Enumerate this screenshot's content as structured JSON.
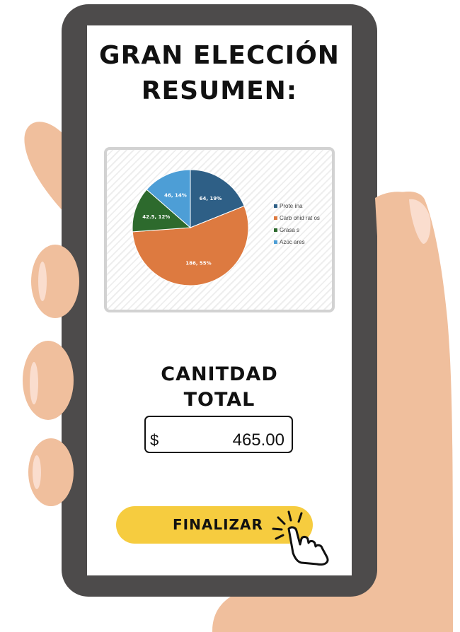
{
  "header": {
    "title_line1": "GRAN ELECCIÓN",
    "title_line2": "RESUMEN:"
  },
  "chart_data": {
    "type": "pie",
    "categories": [
      "Prote ína",
      "Carb ohid rat os",
      "Grasa s",
      "Azúc ares"
    ],
    "values": [
      64,
      186,
      42.5,
      46
    ],
    "percents": [
      19,
      55,
      12,
      14
    ],
    "data_labels": [
      "64, 19%",
      "186, 55%",
      "42.5, 12%",
      "46, 14%"
    ],
    "colors": [
      "#2e5f86",
      "#dd7a40",
      "#2d6a2d",
      "#4d9ed6"
    ],
    "legend_position": "right"
  },
  "total": {
    "label_line1": "CANITDAD",
    "label_line2": "TOTAL",
    "currency": "$",
    "amount": "465.00"
  },
  "actions": {
    "finish_label": "FINALIZAR"
  },
  "icons": {
    "finish_icon": "pointing-hand-click-icon"
  },
  "colors": {
    "button": "#f6cc3f",
    "phone_frame": "#4d4b4b",
    "skin": "#f0bf9d"
  }
}
